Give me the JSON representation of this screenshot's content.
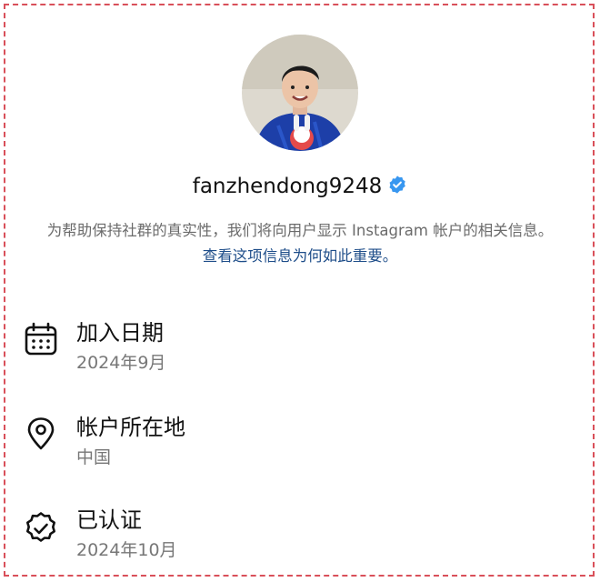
{
  "profile": {
    "username": "fanzhendong9248",
    "verified_icon": "verified-badge-icon",
    "avatar_alt": "profile-photo"
  },
  "notice": {
    "text": "为帮助保持社群的真实性，我们将向用户显示 Instagram 帐户的相关信息。",
    "link": "查看这项信息为何如此重要。"
  },
  "info": [
    {
      "icon": "calendar-icon",
      "label": "加入日期",
      "value": "2024年9月"
    },
    {
      "icon": "location-pin-icon",
      "label": "帐户所在地",
      "value": "中国"
    },
    {
      "icon": "verified-seal-icon",
      "label": "已认证",
      "value": "2024年10月"
    }
  ],
  "colors": {
    "verified_badge": "#3897f0",
    "link": "#1f4e8a",
    "frame_border": "#d9505a"
  }
}
